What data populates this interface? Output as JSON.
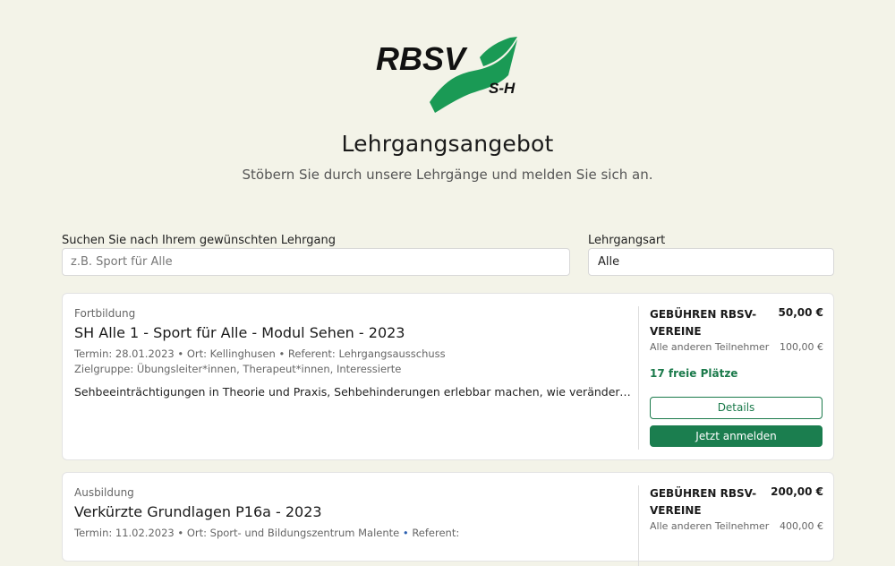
{
  "logo": {
    "main_text": "RBSV",
    "sub_text": "S-H",
    "accent": "#1a9a55"
  },
  "header": {
    "title": "Lehrgangsangebot",
    "subtitle": "Stöbern Sie durch unsere Lehrgänge und melden Sie sich an."
  },
  "filters": {
    "search_label": "Suchen Sie nach Ihrem gewünschten Lehrgang",
    "search_placeholder": "z.B. Sport für Alle",
    "search_value": "",
    "type_label": "Lehrgangsart",
    "type_value": "Alle"
  },
  "courses": [
    {
      "category": "Fortbildung",
      "title": "SH Alle 1 - Sport für Alle - Modul Sehen - 2023",
      "meta": "Termin: 28.01.2023 • Ort: Kellinghusen • Referent: Lehrgangsausschuss",
      "target_group": "Zielgruppe: Übungsleiter*innen, Therapeut*innen, Interessierte",
      "description": "Sehbeeinträchtigungen in Theorie und Praxis, Sehbehinderungen erlebbar machen, wie verändere ich diesbe...",
      "fee_label": "GEBÜHREN RBSV-VEREINE",
      "fee_value": "50,00 €",
      "other_label": "Alle anderen Teilnehmer",
      "other_value": "100,00 €",
      "seats": "17 freie Plätze",
      "details_label": "Details",
      "register_label": "Jetzt anmelden"
    },
    {
      "category": "Ausbildung",
      "title": "Verkürzte Grundlagen P16a - 2023",
      "meta_date": "Termin: 11.02.2023",
      "meta_place": "Ort: Sport- und Bildungszentrum Malente",
      "meta_referent": "Referent:",
      "fee_label": "GEBÜHREN RBSV-VEREINE",
      "fee_value": "200,00 €",
      "other_label": "Alle anderen Teilnehmer",
      "other_value": "400,00 €"
    }
  ],
  "colors": {
    "background": "#f3f3e8",
    "brand_green": "#1b7e4f",
    "seats_green": "#1b7a4b",
    "link_blue": "#2b5fb0"
  }
}
